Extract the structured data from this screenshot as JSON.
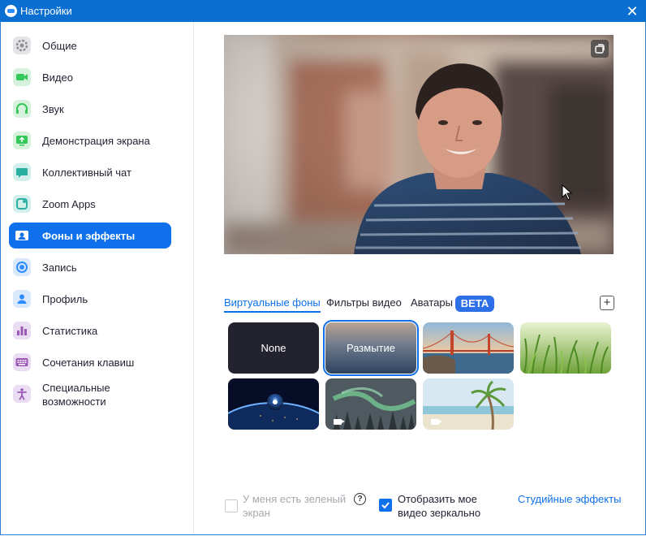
{
  "window": {
    "title": "Настройки",
    "close_glyph": "✕"
  },
  "sidebar": {
    "items": [
      {
        "label": "Общие",
        "icon": "gear-icon",
        "color": "#8e8e93"
      },
      {
        "label": "Видео",
        "icon": "video-camera-icon",
        "color": "#34c759"
      },
      {
        "label": "Звук",
        "icon": "headphones-icon",
        "color": "#34c759"
      },
      {
        "label": "Демонстрация экрана",
        "icon": "share-screen-icon",
        "color": "#34c759"
      },
      {
        "label": "Коллективный чат",
        "icon": "chat-bubble-icon",
        "color": "#2ab0a0"
      },
      {
        "label": "Zoom Apps",
        "icon": "apps-icon",
        "color": "#2ab0a0"
      },
      {
        "label": "Фоны и эффекты",
        "icon": "background-icon",
        "color": "#ffffff",
        "active": true
      },
      {
        "label": "Запись",
        "icon": "record-icon",
        "color": "#2d8cff"
      },
      {
        "label": "Профиль",
        "icon": "profile-icon",
        "color": "#2d8cff"
      },
      {
        "label": "Статистика",
        "icon": "bar-chart-icon",
        "color": "#9b59b6"
      },
      {
        "label": "Сочетания клавиш",
        "icon": "keyboard-icon",
        "color": "#9b59b6"
      },
      {
        "label_line1": "Специальные",
        "label_line2": "возможности",
        "icon": "accessibility-icon",
        "color": "#9b59b6"
      }
    ]
  },
  "tabs": {
    "virtual_backgrounds": "Виртуальные фоны",
    "video_filters": "Фильтры видео",
    "avatars": "Аватары",
    "beta_badge": "BETA",
    "add_symbol": "+"
  },
  "backgrounds": [
    {
      "label": "None"
    },
    {
      "label": "Размытие",
      "selected": true
    },
    {
      "label": "",
      "name": "golden-gate-bridge"
    },
    {
      "label": "",
      "name": "grass"
    },
    {
      "label": "",
      "name": "earth-from-space"
    },
    {
      "label": "",
      "name": "northern-lights",
      "video": true
    },
    {
      "label": "",
      "name": "beach-palm",
      "video": true
    }
  ],
  "footer": {
    "green_screen_line1": "У меня есть зеленый",
    "green_screen_line2": "экран",
    "help_glyph": "?",
    "mirror_line1": "Отобразить мое",
    "mirror_line2": "видео зеркально",
    "studio_effects": "Студийные эффекты",
    "green_screen_checked": false,
    "mirror_checked": true
  },
  "colors": {
    "accent": "#0e71eb",
    "titlebar": "#0b6ed1"
  }
}
